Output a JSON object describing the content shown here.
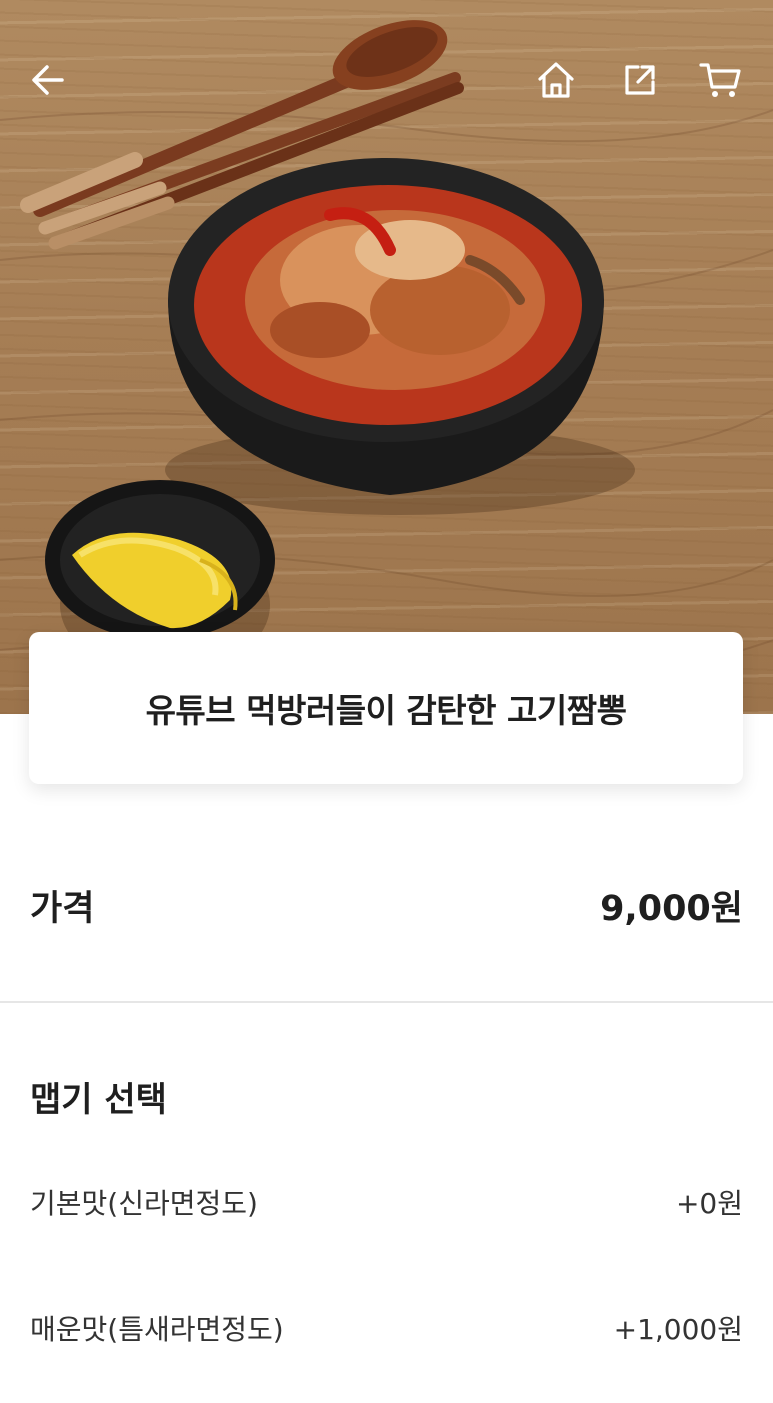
{
  "header": {
    "icons": {
      "back": "arrow-left-icon",
      "home": "home-icon",
      "share": "share-icon",
      "cart": "cart-icon"
    }
  },
  "product": {
    "title": "유튜브 먹방러들이 감탄한 고기짬뽕",
    "price_label": "가격",
    "price_value": "9,000원"
  },
  "spice": {
    "section_title": "맵기 선택",
    "options": [
      {
        "name": "기본맛(신라면정도)",
        "add_price": "+0원"
      },
      {
        "name": "매운맛(틈새라면정도)",
        "add_price": "+1,000원"
      }
    ]
  },
  "colors": {
    "text": "#1f1f1f",
    "divider": "#e6e6e6",
    "header_icon": "#ffffff"
  }
}
